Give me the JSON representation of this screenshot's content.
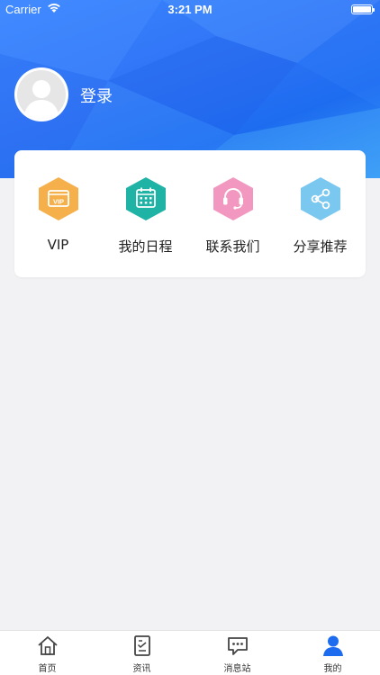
{
  "status_bar": {
    "carrier": "Carrier",
    "time": "3:21 PM"
  },
  "profile": {
    "login_label": "登录"
  },
  "features": [
    {
      "label": "VIP",
      "icon": "vip-icon",
      "color": "#f5b04b"
    },
    {
      "label": "我的日程",
      "icon": "calendar-icon",
      "color": "#1fb3a5"
    },
    {
      "label": "联系我们",
      "icon": "headset-icon",
      "color": "#f297bf"
    },
    {
      "label": "分享推荐",
      "icon": "share-icon",
      "color": "#7ac7ef"
    }
  ],
  "tabbar": {
    "items": [
      {
        "label": "首页",
        "icon": "home-icon"
      },
      {
        "label": "资讯",
        "icon": "news-icon"
      },
      {
        "label": "消息站",
        "icon": "message-icon"
      },
      {
        "label": "我的",
        "icon": "profile-icon",
        "active": true
      }
    ]
  },
  "colors": {
    "header_blue": "#2f73f5",
    "active_tab": "#1d6cf0",
    "page_bg": "#f2f2f4"
  }
}
